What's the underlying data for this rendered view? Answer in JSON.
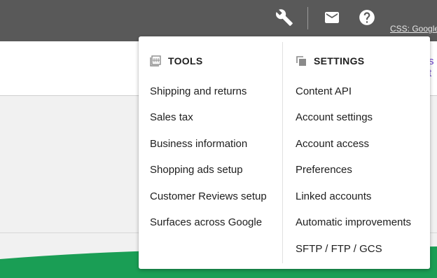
{
  "header": {
    "account_text": "CSS: Google",
    "icons": [
      "wrench-icon",
      "mail-icon",
      "help-icon"
    ]
  },
  "subheader": {
    "link_fragment": "s t"
  },
  "menu": {
    "tools": {
      "title": "TOOLS",
      "icon": "tools-icon",
      "items": [
        "Shipping and returns",
        "Sales tax",
        "Business information",
        "Shopping ads setup",
        "Customer Reviews setup",
        "Surfaces across Google"
      ]
    },
    "settings": {
      "title": "SETTINGS",
      "icon": "settings-copy-icon",
      "items": [
        "Content API",
        "Account settings",
        "Account access",
        "Preferences",
        "Linked accounts",
        "Automatic improvements",
        "SFTP / FTP / GCS"
      ]
    }
  },
  "colors": {
    "topbar": "#595959",
    "green": "#1a9e55",
    "text": "#202020"
  }
}
